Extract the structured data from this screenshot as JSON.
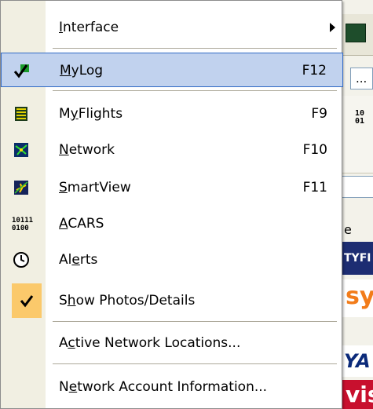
{
  "menu": {
    "items": [
      {
        "label_pre": "",
        "label_u": "I",
        "label_post": "nterface",
        "shortcut": "",
        "submenu": true
      },
      {
        "label_pre": "",
        "label_u": "M",
        "label_post": "yLog",
        "shortcut": "F12",
        "selected": true
      },
      {
        "label_pre": "M",
        "label_u": "y",
        "label_post": "Flights",
        "shortcut": "F9"
      },
      {
        "label_pre": "",
        "label_u": "N",
        "label_post": "etwork",
        "shortcut": "F10"
      },
      {
        "label_pre": "",
        "label_u": "S",
        "label_post": "martView",
        "shortcut": "F11"
      },
      {
        "label_pre": "",
        "label_u": "A",
        "label_post": "CARS",
        "shortcut": ""
      },
      {
        "label_pre": "Al",
        "label_u": "e",
        "label_post": "rts",
        "shortcut": ""
      },
      {
        "label_pre": "S",
        "label_u": "h",
        "label_post": "ow Photos/Details",
        "shortcut": "",
        "checked": true
      },
      {
        "label_pre": "A",
        "label_u": "c",
        "label_post": "tive Network Locations...",
        "shortcut": ""
      },
      {
        "label_pre": "N",
        "label_u": "e",
        "label_post": "twork Account Information...",
        "shortcut": ""
      }
    ],
    "icons": [
      "check-green-icon",
      "flights-list-icon",
      "network-globe-icon",
      "smartview-plane-icon",
      "acars-binary-icon",
      "alerts-clock-icon",
      "checkmark-icon"
    ],
    "acars_icon_text": [
      "10111",
      "0100"
    ]
  },
  "background": {
    "button_label": "...",
    "binary_text": [
      "10",
      "01"
    ],
    "column_header_fragment": "e",
    "logo1_text": "TYFI",
    "logo2_text": "sy",
    "logo3_text": "YA",
    "logo4_text": "vis"
  },
  "colors": {
    "selection_bg": "#c1d2ee",
    "selection_border": "#316ac5",
    "gutter": "#f1efe2"
  }
}
